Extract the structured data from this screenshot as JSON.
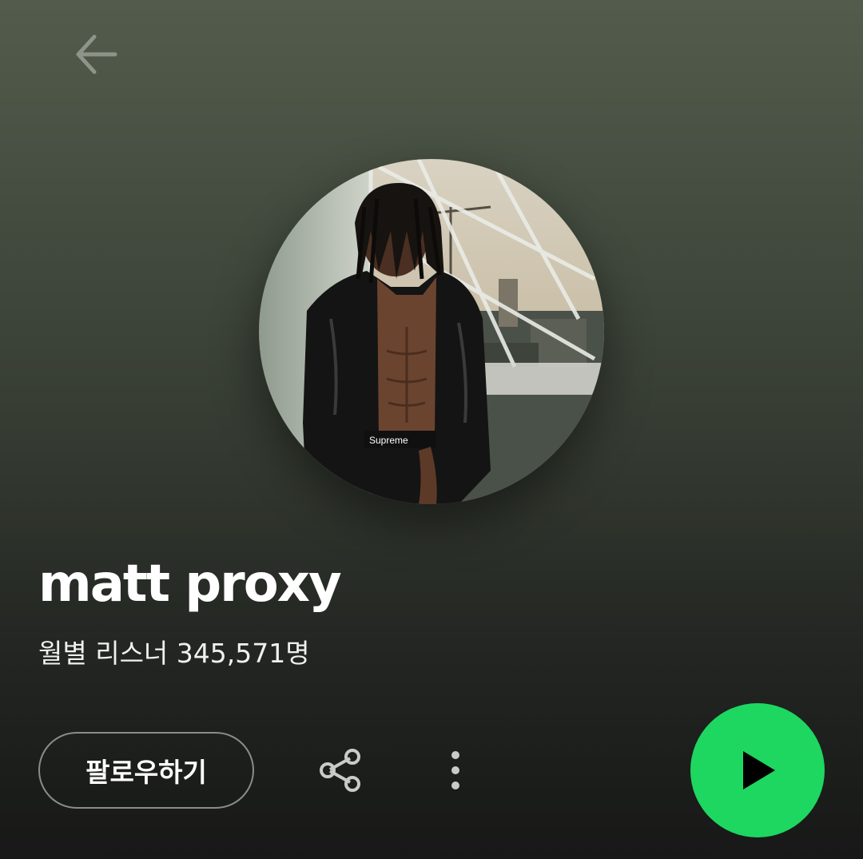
{
  "header": {
    "back_icon": "arrow-left-icon"
  },
  "artist": {
    "name": "matt proxy",
    "monthly_listeners": "월별 리스너 345,571명",
    "shirt_text": "Supreme"
  },
  "actions": {
    "follow_label": "팔로우하기",
    "share_icon": "share-icon",
    "more_icon": "more-vertical-icon",
    "play_icon": "play-icon"
  },
  "colors": {
    "accent": "#1ed760",
    "background_top": "#535c4c",
    "background_bottom": "#171817",
    "follow_border": "#8a8d86"
  }
}
